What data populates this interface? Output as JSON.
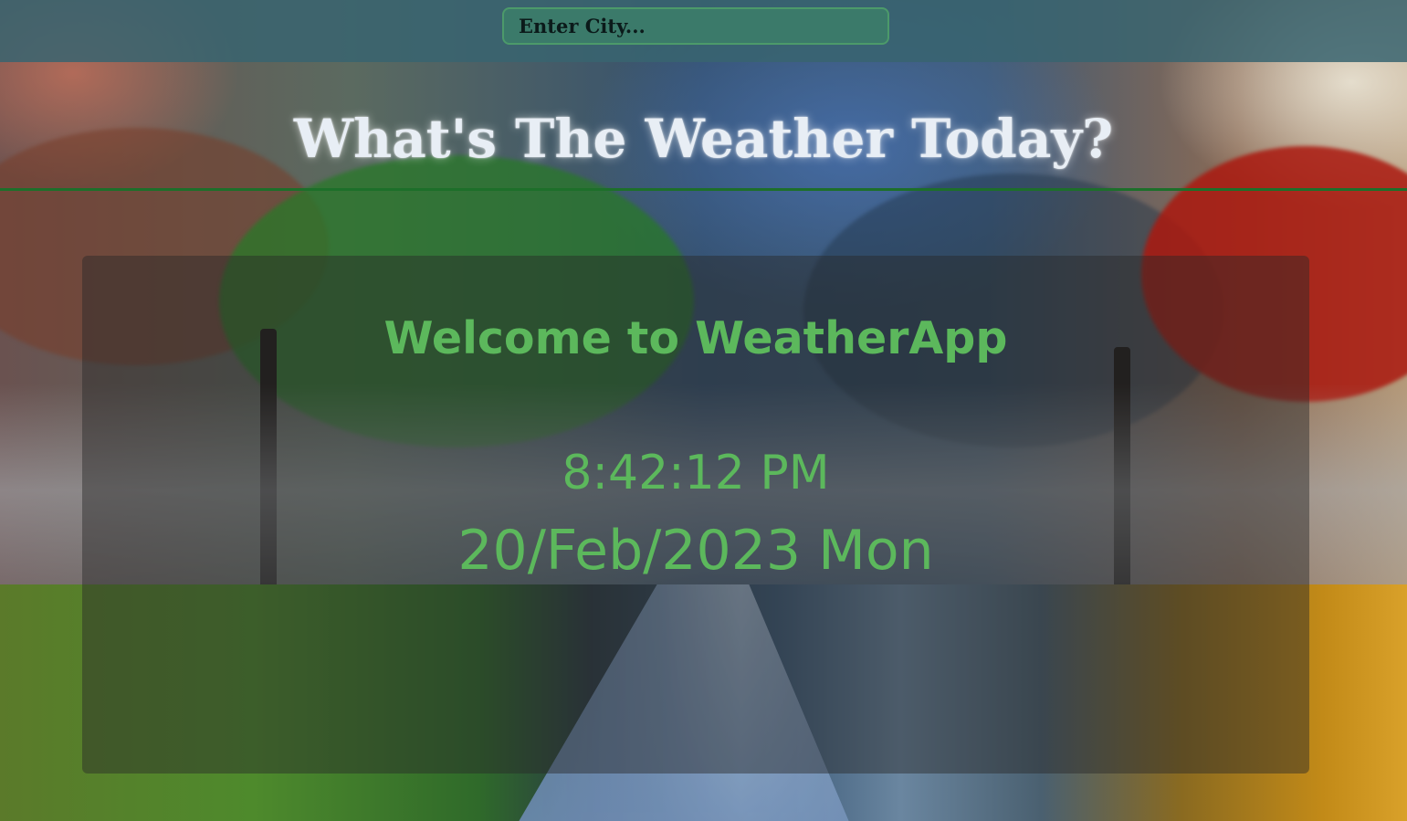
{
  "search": {
    "placeholder": "Enter City..."
  },
  "header": {
    "title": "What's The Weather Today?"
  },
  "welcome": {
    "heading": "Welcome to WeatherApp",
    "time": "8:42:12 PM",
    "date": "20/Feb/2023 Mon"
  },
  "colors": {
    "accent": "#5cb85c",
    "divider": "#1d6f2a",
    "topbar": "#386470",
    "title": "#e8eef5"
  }
}
